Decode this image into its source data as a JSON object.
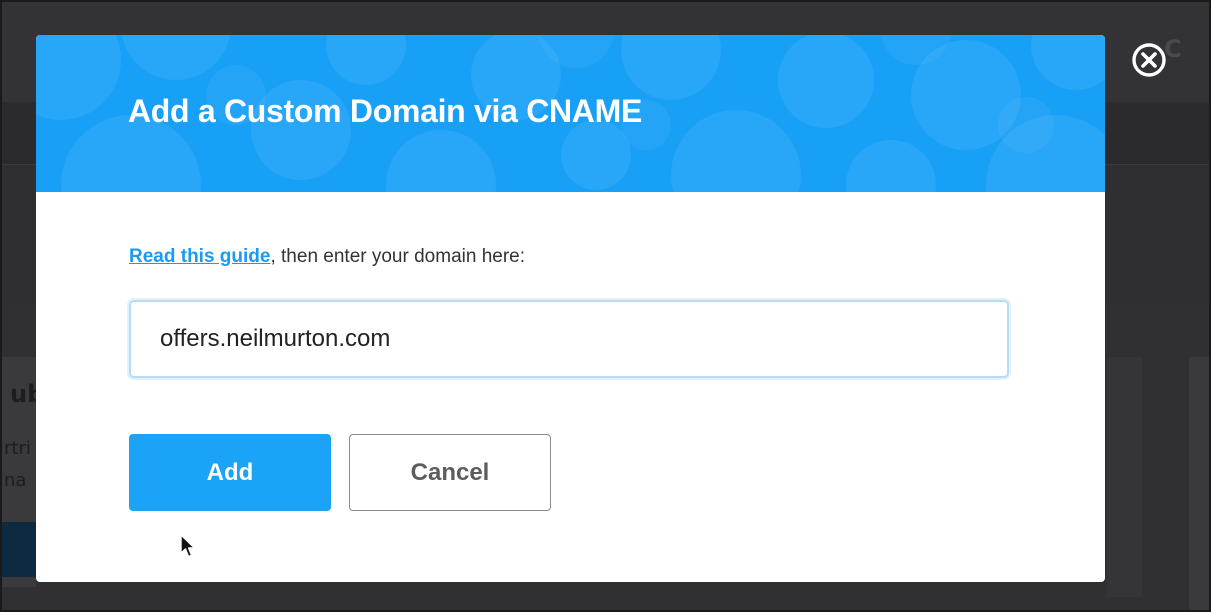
{
  "modal": {
    "title": "Add a Custom Domain via CNAME",
    "instruction_link": "Read this guide",
    "instruction_text": ", then enter your domain here:",
    "domain_input_value": "offers.neilmurton.com",
    "add_label": "Add",
    "cancel_label": "Cancel",
    "close_icon": "close-circle-icon"
  },
  "background": {
    "card_title_fragment": "ub",
    "card_line1_fragment": "rtri",
    "card_line2_fragment": "na",
    "top_right_fragment": "C"
  },
  "colors": {
    "header_blue": "#18a0f7",
    "add_button": "#1ba4f7",
    "link": "#1b9bef",
    "overlay": "#2f2f31"
  }
}
